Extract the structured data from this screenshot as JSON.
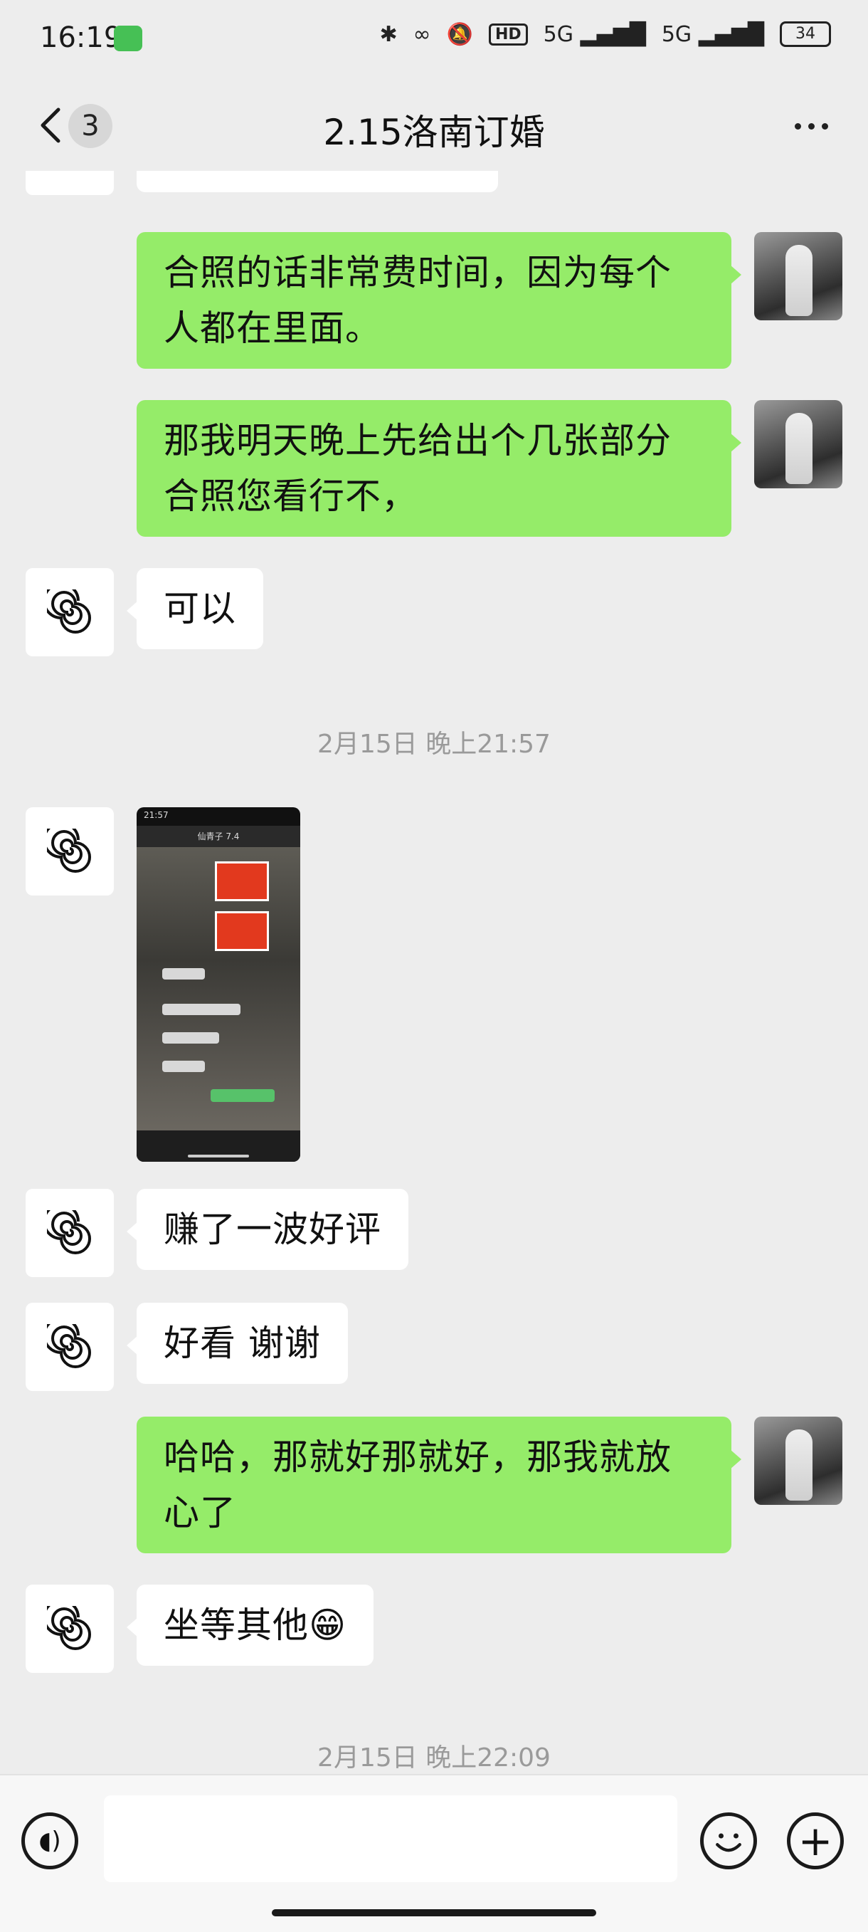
{
  "status_bar": {
    "time": "16:19",
    "network_badge": "HD",
    "signal_1": "5G",
    "signal_2": "5G",
    "battery": "34"
  },
  "header": {
    "unread_count": "3",
    "title": "2.15洛南订婚"
  },
  "messages": [
    {
      "side": "right",
      "text": "合照的话非常费时间，因为每个人都在里面。"
    },
    {
      "side": "right",
      "text": "那我明天晚上先给出个几张部分合照您看行不，"
    },
    {
      "side": "left",
      "text": "可以"
    },
    {
      "type": "timestamp",
      "text": "2月15日 晚上21:57"
    },
    {
      "side": "left",
      "type": "image",
      "thumb_time": "21:57",
      "thumb_title": "仙青子 7.4"
    },
    {
      "side": "left",
      "text": "赚了一波好评"
    },
    {
      "side": "left",
      "text": "好看 谢谢"
    },
    {
      "side": "right",
      "text": "哈哈，那就好那就好，那我就放心了"
    },
    {
      "side": "left",
      "text": "坐等其他😁"
    },
    {
      "type": "timestamp",
      "text": "2月15日 晚上22:09"
    }
  ],
  "input_bar": {
    "placeholder": "",
    "plus": "+"
  },
  "colors": {
    "background": "#ededed",
    "bubble_self": "#95ec69",
    "bubble_other": "#ffffff"
  }
}
